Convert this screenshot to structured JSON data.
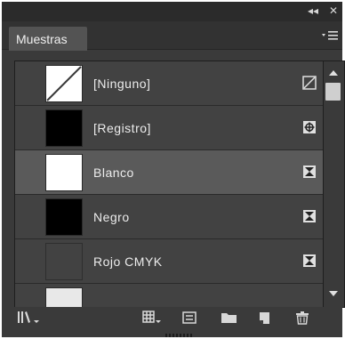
{
  "window": {
    "collapse_icon": "double-chevron-left-icon",
    "close_icon": "close-icon"
  },
  "tab": {
    "label": "Muestras",
    "menu_icon": "panel-menu-icon"
  },
  "swatches": [
    {
      "label": "[Ninguno]",
      "swatch_color": "none",
      "type_icon": "none-swatch-icon",
      "selected": false
    },
    {
      "label": "[Registro]",
      "swatch_color": "#000000",
      "type_icon": "registration-icon",
      "selected": false
    },
    {
      "label": "Blanco",
      "swatch_color": "#ffffff",
      "type_icon": "process-color-icon",
      "selected": true
    },
    {
      "label": "Negro",
      "swatch_color": "#000000",
      "type_icon": "process-color-icon",
      "selected": false
    },
    {
      "label": "Rojo CMYK",
      "swatch_color": "#424242",
      "type_icon": "process-color-icon",
      "selected": false
    },
    {
      "label": "",
      "swatch_color": "#e8e8e8",
      "type_icon": "",
      "selected": false
    }
  ],
  "toolbar": {
    "icons": [
      "swatch-libraries-icon",
      "show-kinds-icon",
      "swatch-options-icon",
      "new-color-group-icon",
      "new-swatch-icon",
      "delete-swatch-icon"
    ]
  }
}
